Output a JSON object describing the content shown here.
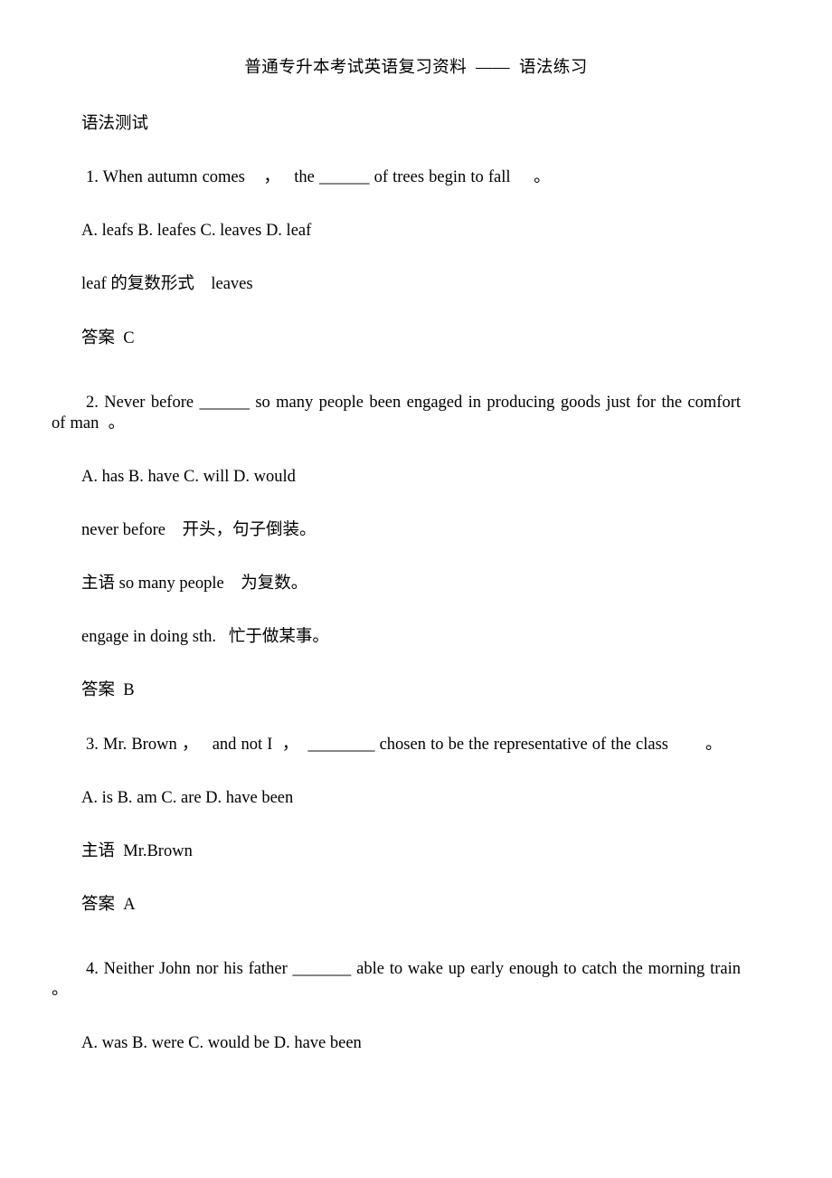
{
  "document": {
    "header": "普通专升本考试英语复习资料  ——  语法练习",
    "section_title": "语法测试"
  },
  "questions": [
    {
      "number": "1",
      "stem": "1. When autumn comes    ，   the ______ of trees begin to fall     。",
      "options": "A. leafs B. leafes C. leaves D. leaf",
      "explanations": [
        "leaf 的复数形式    leaves"
      ],
      "answer": "答案  C"
    },
    {
      "number": "2",
      "stem": "2. Never before ______ so many people been engaged in producing goods just for the comfort of man  。",
      "options": "A. has B. have C. will D. would",
      "explanations": [
        "never before    开头，句子倒装。",
        "主语 so many people    为复数。",
        "engage in doing sth.   忙于做某事。"
      ],
      "answer": "答案  B"
    },
    {
      "number": "3",
      "stem": "3. Mr. Brown ，   and not I  ，  ________ chosen to be the representative of the class        。",
      "options": "A. is B. am C. are D. have been",
      "explanations": [
        "主语  Mr.Brown"
      ],
      "answer": "答案  A"
    },
    {
      "number": "4",
      "stem": "4. Neither John nor his father _______ able to wake up early enough to catch the morning train 。",
      "options": "A. was B. were C. would be D. have been",
      "explanations": [],
      "answer": ""
    }
  ]
}
